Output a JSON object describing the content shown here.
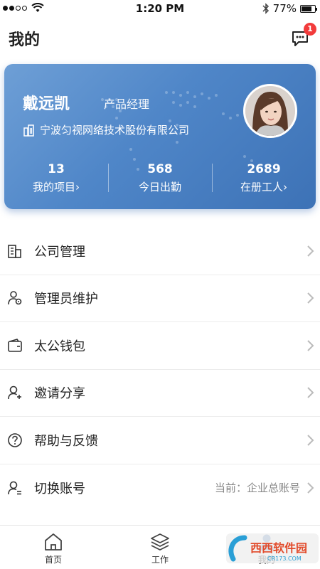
{
  "status_bar": {
    "time": "1:20 PM",
    "battery": "77%",
    "battery_level": 0.77
  },
  "header": {
    "title": "我的",
    "message_badge": "1",
    "message_icon": "chat-bubble-icon"
  },
  "profile": {
    "name": "戴远凯",
    "role": "产品经理",
    "company": "宁波匀视网络技术股份有限公司",
    "stats": [
      {
        "value": "13",
        "label": "我的项目›"
      },
      {
        "value": "568",
        "label": "今日出勤"
      },
      {
        "value": "2689",
        "label": "在册工人›"
      }
    ]
  },
  "menu": {
    "items": [
      {
        "label": "公司管理",
        "icon": "building-icon"
      },
      {
        "label": "管理员维护",
        "icon": "admin-users-icon"
      },
      {
        "label": "太公钱包",
        "icon": "wallet-icon"
      },
      {
        "label": "邀请分享",
        "icon": "invite-user-icon"
      },
      {
        "label": "帮助与反馈",
        "icon": "help-icon"
      },
      {
        "label": "切换账号",
        "icon": "switch-account-icon",
        "extra": "当前：企业总账号"
      }
    ]
  },
  "tabs": [
    {
      "label": "首页",
      "icon": "home-icon"
    },
    {
      "label": "工作",
      "icon": "layers-icon"
    },
    {
      "label": "我的",
      "icon": "profile-icon",
      "active": true
    }
  ],
  "watermark": {
    "text": "西西软件园",
    "subtext": "CR173.COM"
  },
  "colors": {
    "card_gradient_start": "#6e9fd6",
    "card_gradient_end": "#3d72b6",
    "badge": "#f23b3b"
  }
}
